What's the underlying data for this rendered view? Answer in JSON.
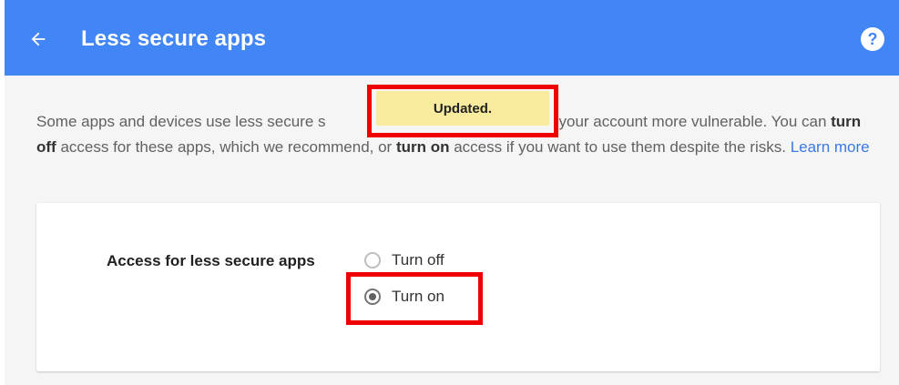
{
  "header": {
    "title": "Less secure apps",
    "back_icon": "arrow-left-icon",
    "help_icon": "help-icon",
    "help_glyph": "?",
    "color": "#4285f4"
  },
  "description": {
    "part1": "Some apps and devices use less secure s",
    "part2": "h makes your account more vulnerable. You can ",
    "bold1": "turn off",
    "part3": " access for these apps, which we recommend, or ",
    "bold2": "turn on",
    "part4": " access if you want to use them despite the risks. ",
    "link": "Learn more"
  },
  "toast": {
    "text": "Updated."
  },
  "setting": {
    "label": "Access for less secure apps",
    "options": [
      {
        "label": "Turn off",
        "selected": false
      },
      {
        "label": "Turn on",
        "selected": true
      }
    ]
  }
}
